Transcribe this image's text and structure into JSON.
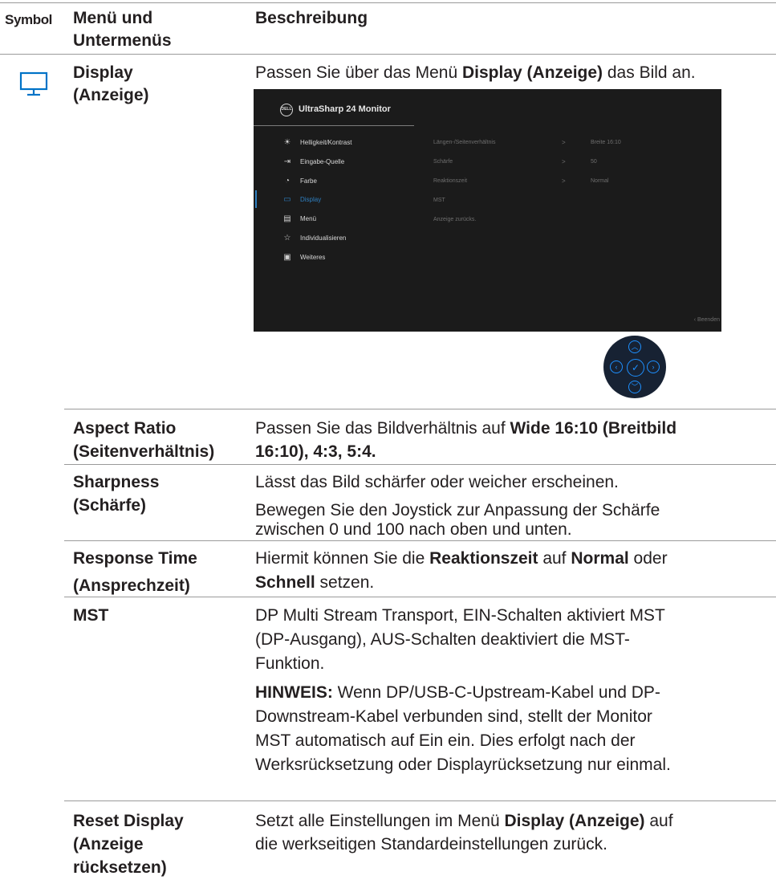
{
  "header": {
    "col_symbol": "Symbol",
    "col_menu_line1": "Menü und",
    "col_menu_line2": "Untermenüs",
    "col_desc": "Beschreibung"
  },
  "display_row": {
    "name_line1": "Display",
    "name_line2": "(Anzeige)",
    "desc_pre": "Passen Sie über das Menü ",
    "desc_bold": "Display (Anzeige)",
    "desc_post": " das Bild an."
  },
  "osd": {
    "brand": "DELL",
    "title": "UltraSharp 24 Monitor",
    "menu": [
      {
        "icon": "brightness-icon",
        "label": "Helligkeit/Kontrast"
      },
      {
        "icon": "input-source-icon",
        "label": "Eingabe-Quelle"
      },
      {
        "icon": "color-palette-icon",
        "label": "Farbe"
      },
      {
        "icon": "display-icon",
        "label": "Display"
      },
      {
        "icon": "menu-icon",
        "label": "Menü"
      },
      {
        "icon": "star-icon",
        "label": "Individualisieren"
      },
      {
        "icon": "others-icon",
        "label": "Weiteres"
      }
    ],
    "submenu": [
      {
        "label": "Längen-/Seitenverhältnis",
        "chevron": ">",
        "value": "Breite 16:10"
      },
      {
        "label": "Schärfe",
        "chevron": ">",
        "value": "50"
      },
      {
        "label": "Reaktionszeit",
        "chevron": ">",
        "value": "Normal"
      },
      {
        "label": "MST",
        "chevron": "",
        "value": ""
      },
      {
        "label": "Anzeige zurücks.",
        "chevron": "",
        "value": ""
      }
    ],
    "exit": "‹  Beenden"
  },
  "rows": {
    "aspect": {
      "name1": "Aspect Ratio",
      "name2": "(Seitenverhältnis)",
      "d_pre": "Passen Sie das Bildverhältnis auf ",
      "d_bold1": "Wide 16:10 (Breitbild",
      "d_bold2": "16:10), 4:3, 5:4."
    },
    "sharpness": {
      "name1": "Sharpness",
      "name2": "(Schärfe)",
      "d1": "Lässt das Bild schärfer oder weicher erscheinen.",
      "d2a": "Bewegen Sie den Joystick zur Anpassung der Schärfe",
      "d2b": "zwischen 0 und 100 nach oben und unten."
    },
    "response": {
      "name1": "Response Time",
      "name2": "(Ansprechzeit)",
      "d_pre": "Hiermit können Sie die ",
      "d_bold1": "Reaktionszeit",
      "d_mid": " auf ",
      "d_bold2": "Normal",
      "d_post": " oder",
      "d_bold3": "Schnell",
      "d_end": " setzen."
    },
    "mst": {
      "name": "MST",
      "d1": "DP Multi Stream Transport,  EIN-Schalten aktiviert MST",
      "d2": "(DP-Ausgang), AUS-Schalten deaktiviert die MST-",
      "d3": "Funktion.",
      "note_label": "HINWEIS:",
      "n1": " Wenn DP/USB-C-Upstream-Kabel und DP-",
      "n2": "Downstream-Kabel verbunden sind, stellt der Monitor",
      "n3": "MST automatisch auf Ein ein. Dies erfolgt nach der",
      "n4": "Werksrücksetzung oder Displayrücksetzung nur einmal."
    },
    "reset": {
      "name1": "Reset Display",
      "name2": "(Anzeige",
      "name3": "rücksetzen)",
      "d_pre": "Setzt alle Einstellungen im Menü ",
      "d_bold": "Display (Anzeige)",
      "d_post": " auf",
      "d2": "die werkseitigen Standardeinstellungen zurück."
    }
  }
}
